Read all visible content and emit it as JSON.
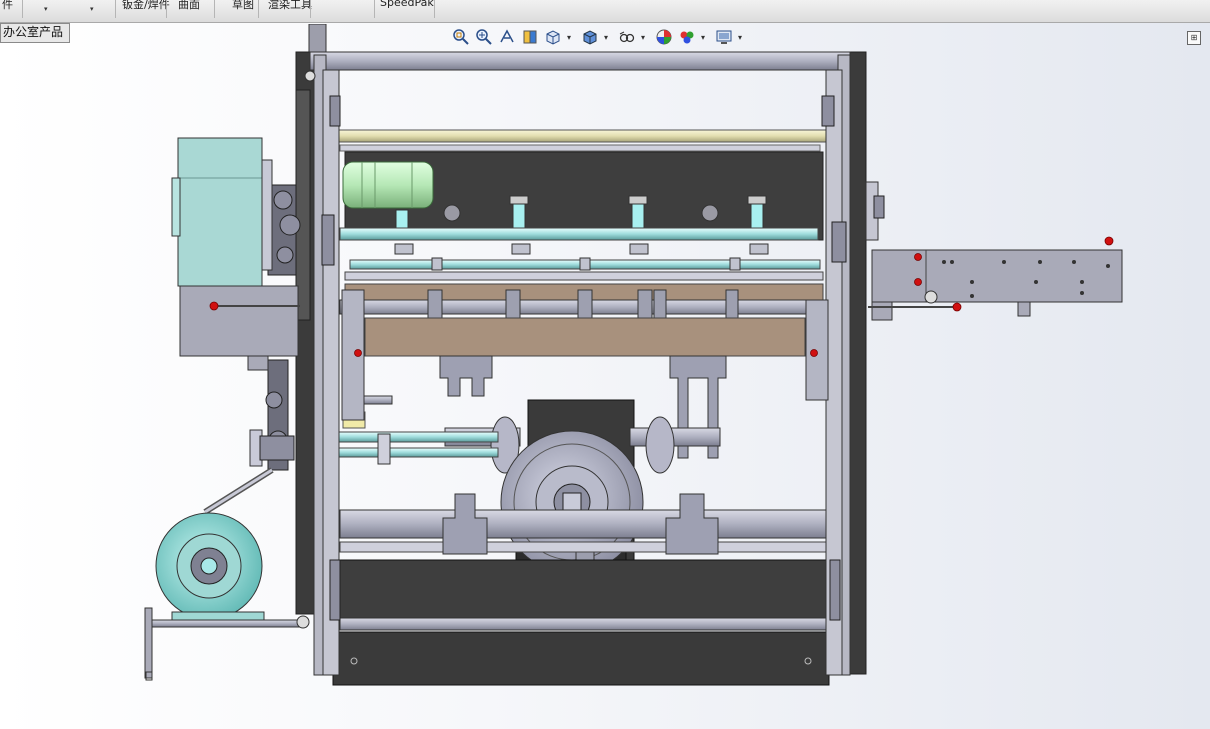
{
  "ribbon": {
    "items": [
      {
        "label": "件"
      },
      {
        "label": "▾"
      },
      {
        "label": "▾"
      },
      {
        "label": "钣金/焊件"
      },
      {
        "label": "曲面"
      },
      {
        "label": "草图"
      },
      {
        "label": "渲染工具"
      },
      {
        "label": "SpeedPak"
      }
    ]
  },
  "breadcrumb": {
    "label": "办公室产品"
  },
  "hud": {
    "tools": [
      {
        "icon": "zoom-to-fit-icon"
      },
      {
        "icon": "zoom-to-area-icon"
      },
      {
        "icon": "previous-view-icon"
      },
      {
        "icon": "section-view-icon"
      },
      {
        "icon": "view-orientation-icon"
      },
      {
        "icon": "display-style-icon"
      },
      {
        "icon": "hide-show-items-icon"
      },
      {
        "icon": "edit-appearance-icon"
      },
      {
        "icon": "view-settings-icon"
      }
    ]
  },
  "colors": {
    "frame_gray": "#a9aab8",
    "dark_panel": "#3d3d3d",
    "motor_green": "#b6e8b6",
    "motor_teal": "#9fd8d8",
    "brown_plate": "#a8917d",
    "marker_red": "#d01010",
    "shaft_cyan": "#b8f0f0"
  }
}
